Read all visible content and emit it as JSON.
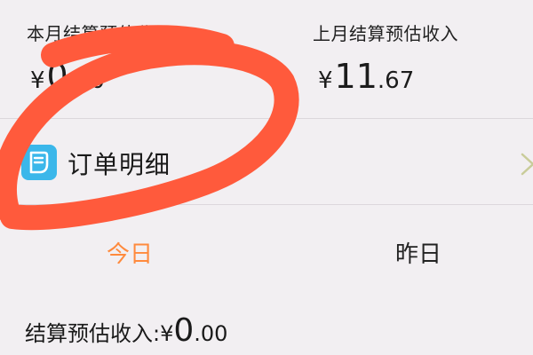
{
  "income": {
    "current_month": {
      "label": "本月结算预估收入",
      "currency": "¥",
      "integer": "0",
      "decimal": ".00"
    },
    "last_month": {
      "label": "上月结算预估收入",
      "currency": "¥",
      "integer": "11",
      "decimal": ".67"
    }
  },
  "order_detail": {
    "label": "订单明细",
    "icon": "document-icon"
  },
  "tabs": [
    {
      "label": "今日",
      "active": true
    },
    {
      "label": "昨日",
      "active": false
    }
  ],
  "settlement": {
    "label": "结算预估收入:",
    "currency": "¥",
    "integer": "0",
    "decimal": ".00"
  },
  "colors": {
    "accent": "#ff8a3d",
    "annotation": "#ff5a3c",
    "icon_bg": "#3bb7ea"
  }
}
